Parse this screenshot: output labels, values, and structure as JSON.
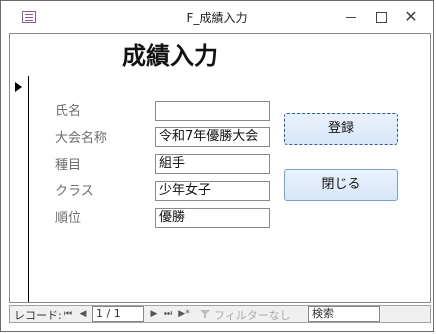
{
  "window": {
    "title": "F_成績入力"
  },
  "form": {
    "heading": "成績入力",
    "fields": [
      {
        "label": "氏名",
        "value": ""
      },
      {
        "label": "大会名称",
        "value": "令和7年優勝大会"
      },
      {
        "label": "種目",
        "value": "組手"
      },
      {
        "label": "クラス",
        "value": "少年女子"
      },
      {
        "label": "順位",
        "value": "優勝"
      }
    ],
    "register_label": "登録",
    "close_label": "閉じる"
  },
  "navbar": {
    "record_label": "レコード:",
    "position": "1 / 1",
    "filter_label": "フィルターなし",
    "search_placeholder": "検索"
  },
  "icons": [
    "form-icon",
    "minimize-icon",
    "maximize-icon",
    "close-icon",
    "record-selector-arrow-icon",
    "first-record-icon",
    "prev-record-icon",
    "next-record-icon",
    "last-record-icon",
    "new-record-icon",
    "filter-icon"
  ]
}
